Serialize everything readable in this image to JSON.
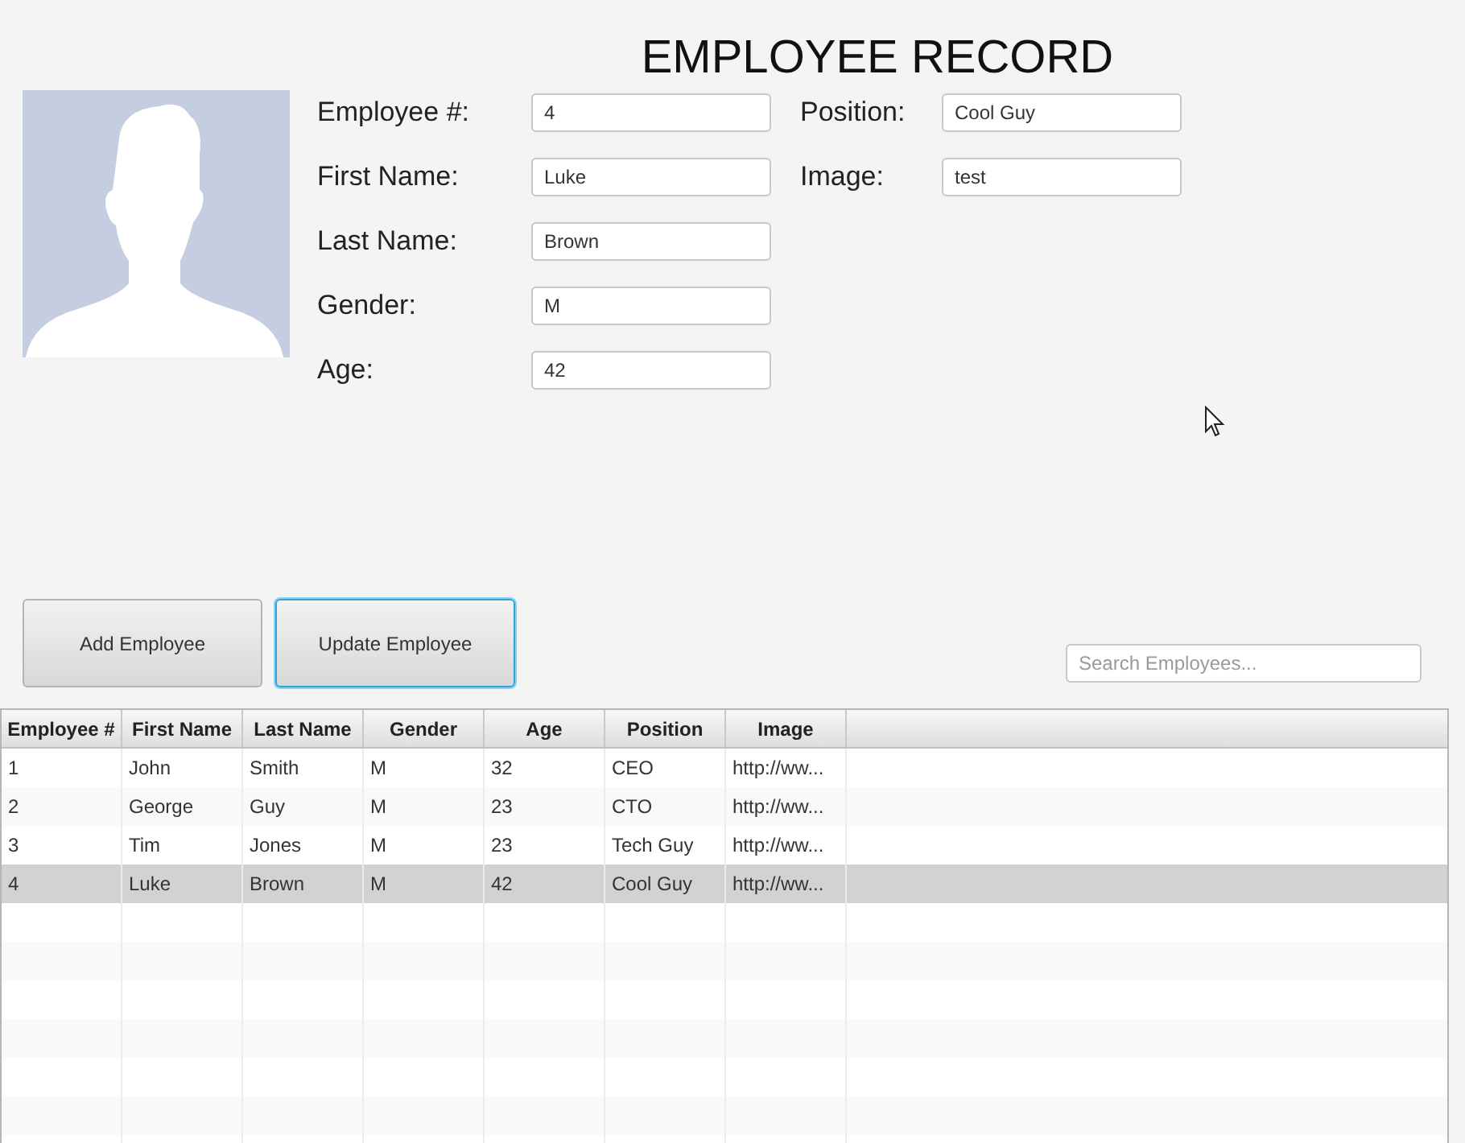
{
  "title": "EMPLOYEE RECORD",
  "form": {
    "left": [
      {
        "label": "Employee #:",
        "value": "4"
      },
      {
        "label": "First Name:",
        "value": "Luke"
      },
      {
        "label": "Last Name:",
        "value": "Brown"
      },
      {
        "label": "Gender:",
        "value": "M"
      },
      {
        "label": "Age:",
        "value": "42"
      }
    ],
    "right": [
      {
        "label": "Position:",
        "value": "Cool Guy"
      },
      {
        "label": "Image:",
        "value": "test"
      }
    ]
  },
  "buttons": [
    {
      "label": "Add Employee",
      "focused": false
    },
    {
      "label": "Update Employee",
      "focused": true
    }
  ],
  "search": {
    "placeholder": "Search Employees..."
  },
  "table": {
    "columns": [
      "Employee #",
      "First Name",
      "Last Name",
      "Gender",
      "Age",
      "Position",
      "Image"
    ],
    "rows": [
      {
        "cells": [
          "1",
          "John",
          "Smith",
          "M",
          "32",
          "CEO",
          "http://ww..."
        ],
        "selected": false
      },
      {
        "cells": [
          "2",
          "George",
          "Guy",
          "M",
          "23",
          "CTO",
          "http://ww..."
        ],
        "selected": false
      },
      {
        "cells": [
          "3",
          "Tim",
          "Jones",
          "M",
          "23",
          "Tech Guy",
          "http://ww..."
        ],
        "selected": false
      },
      {
        "cells": [
          "4",
          "Luke",
          "Brown",
          "M",
          "42",
          "Cool Guy",
          "http://ww..."
        ],
        "selected": true
      }
    ]
  }
}
